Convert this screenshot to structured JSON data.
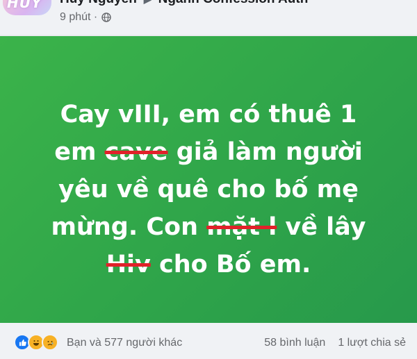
{
  "header": {
    "avatar_text": "HUY",
    "author": "Huy Nguyễn",
    "group": "Ngành Confession Auth",
    "time": "9 phút ·",
    "privacy_icon": "globe-icon"
  },
  "post": {
    "background_color": "#2fa54a",
    "line1": "Cay vIII, em có thuê 1",
    "line2_prefix": "em",
    "line2_strike": "cave",
    "line2_suffix": "giả làm người",
    "line3": "yêu về quê cho bố mẹ",
    "line4_prefix": "mừng. Con",
    "line4_strike": "mặt l",
    "line4_suffix": "về lây",
    "line5_strike": "Hiv",
    "line5_suffix": "cho Bố em.",
    "strike_color": "#e0222a"
  },
  "footer": {
    "reactions": [
      "like-icon",
      "haha-icon",
      "sad-icon"
    ],
    "reactions_text": "Bạn và 577 người khác",
    "comments": "58 bình luận",
    "shares": "1 lượt chia sẻ"
  }
}
